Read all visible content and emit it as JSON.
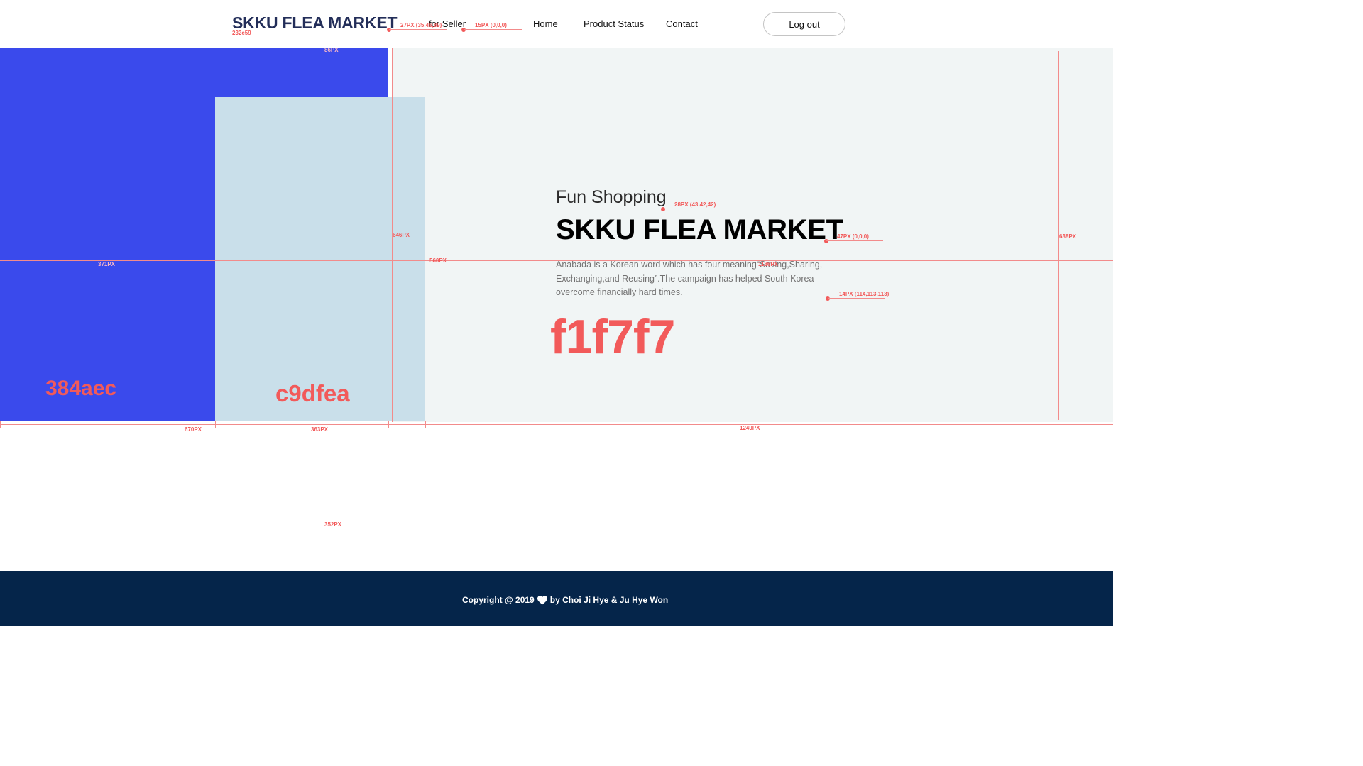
{
  "header": {
    "logo": "SKKU FLEA MARKET",
    "logo_color_label": "232e59",
    "nav": [
      "for Seller",
      "Home",
      "Product Status",
      "Contact"
    ],
    "logout_label": "Log out"
  },
  "hero": {
    "subtitle": "Fun Shopping",
    "title": "SKKU FLEA MARKET",
    "description": "Anabada is a Korean word which has four meaning“Saving,Sharing, Exchanging,and Reusing”.The campaign has helped South Korea overcome financially hard times.",
    "swatches": [
      "384aec",
      "c9dfea",
      "f1f7f7"
    ]
  },
  "annotations": {
    "logo_spec": "27PX (35,46,89)",
    "nav_spec": "15PX (0,0,0)",
    "subtitle_spec": "28PX (43,42,42)",
    "title_spec": "47PX (0,0,0)",
    "desc_spec": "14PX (114,113,113)",
    "w_blue": "670PX",
    "w_lightblue": "363PX",
    "w_gray": "1249PX",
    "h_left": "371PX",
    "h_blue_col": "646PX",
    "h_lightblue": "560PX",
    "h_gray": "638PX",
    "h_bottom": "352PX",
    "top_offset": "86PX",
    "desc_width": "1186PX"
  },
  "colors": {
    "logo": "#232e59",
    "blue": "#3a4aec",
    "lightblue": "#c9dfea",
    "gray": "#f1f5f5",
    "annotation": "#f25a5a",
    "footer": "#05254a"
  },
  "footer": {
    "copyright_left": "Copyright @ 2019",
    "heart_icon": "heart-icon",
    "copyright_right": "by Choi Ji Hye & Ju Hye Won"
  }
}
